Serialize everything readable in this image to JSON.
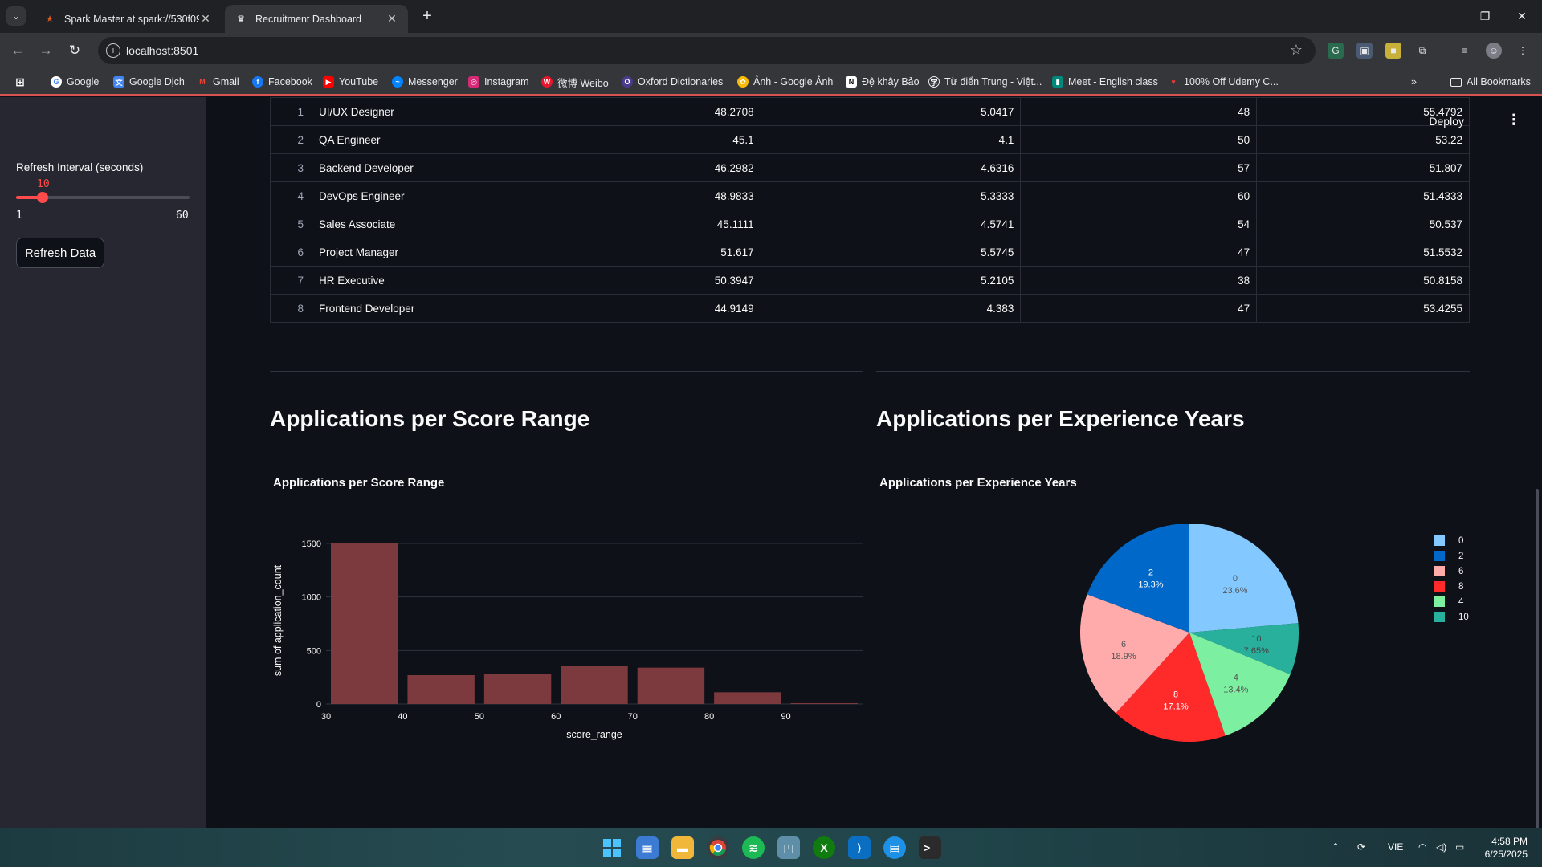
{
  "browser": {
    "tabs": [
      {
        "title": "Spark Master at spark://530f09...",
        "active": false
      },
      {
        "title": "Recruitment Dashboard",
        "active": true
      }
    ],
    "url": "localhost:8501",
    "bookmarks": [
      "Google",
      "Google Dịch",
      "Gmail",
      "Facebook",
      "YouTube",
      "Messenger",
      "Instagram",
      "微博 Weibo",
      "Oxford Dictionaries",
      "Ảnh - Google Ảnh",
      "Đệ khây Bảo",
      "Từ điển Trung - Việt...",
      "Meet - English class",
      "100% Off Udemy C..."
    ],
    "all_bookmarks": "All Bookmarks"
  },
  "sidebar": {
    "slider_label": "Refresh Interval (seconds)",
    "slider_value": "10",
    "slider_min": "1",
    "slider_max": "60",
    "slider_fraction": 0.153,
    "refresh_button": "Refresh Data"
  },
  "header": {
    "deploy": "Deploy",
    "menu_icon": "⋮"
  },
  "table": {
    "rows": [
      [
        "1",
        "UI/UX Designer",
        "48.2708",
        "5.0417",
        "48",
        "55.4792"
      ],
      [
        "2",
        "QA Engineer",
        "45.1",
        "4.1",
        "50",
        "53.22"
      ],
      [
        "3",
        "Backend Developer",
        "46.2982",
        "4.6316",
        "57",
        "51.807"
      ],
      [
        "4",
        "DevOps Engineer",
        "48.9833",
        "5.3333",
        "60",
        "51.4333"
      ],
      [
        "5",
        "Sales Associate",
        "45.1111",
        "4.5741",
        "54",
        "50.537"
      ],
      [
        "6",
        "Project Manager",
        "51.617",
        "5.5745",
        "47",
        "51.5532"
      ],
      [
        "7",
        "HR Executive",
        "50.3947",
        "5.2105",
        "38",
        "50.8158"
      ],
      [
        "8",
        "Frontend Developer",
        "44.9149",
        "4.383",
        "47",
        "53.4255"
      ]
    ]
  },
  "sections": {
    "score_title": "Applications per Score Range",
    "exp_title": "Applications per Experience Years"
  },
  "chart_data": [
    {
      "type": "bar",
      "title": "Applications per Score Range",
      "xlabel": "score_range",
      "ylabel": "sum of application_count",
      "x": [
        30,
        40,
        50,
        60,
        70,
        80,
        90
      ],
      "values": [
        1500,
        270,
        285,
        360,
        340,
        110,
        8
      ],
      "xticks": [
        "30",
        "40",
        "50",
        "60",
        "70",
        "80",
        "90"
      ],
      "yticks": [
        "0",
        "500",
        "1000",
        "1500"
      ],
      "ylim": [
        0,
        1560
      ],
      "xlim": [
        30,
        100
      ],
      "color": "#7c3a3e",
      "grid": true
    },
    {
      "type": "pie",
      "title": "Applications per Experience Years",
      "legend_position": "right",
      "slices": [
        {
          "label": "0",
          "percent": 23.6,
          "text": "23.6%",
          "color": "#83c9ff"
        },
        {
          "label": "10",
          "percent": 7.65,
          "text": "7.65%",
          "color": "#29b09d"
        },
        {
          "label": "4",
          "percent": 13.4,
          "text": "13.4%",
          "color": "#7defa1"
        },
        {
          "label": "8",
          "percent": 17.1,
          "text": "17.1%",
          "color": "#ff2b2b"
        },
        {
          "label": "6",
          "percent": 18.9,
          "text": "18.9%",
          "color": "#ffabab"
        },
        {
          "label": "2",
          "percent": 19.3,
          "text": "19.3%",
          "color": "#0068c9"
        }
      ],
      "legend": [
        {
          "label": "0",
          "color": "#83c9ff"
        },
        {
          "label": "2",
          "color": "#0068c9"
        },
        {
          "label": "6",
          "color": "#ffabab"
        },
        {
          "label": "8",
          "color": "#ff2b2b"
        },
        {
          "label": "4",
          "color": "#7defa1"
        },
        {
          "label": "10",
          "color": "#29b09d"
        }
      ]
    }
  ],
  "taskbar": {
    "lang": "VIE",
    "time": "4:58 PM",
    "date": "6/25/2025"
  },
  "colors": {
    "accent": "#ff4b4b",
    "bg": "#0e1117",
    "sidebar": "#262730"
  }
}
